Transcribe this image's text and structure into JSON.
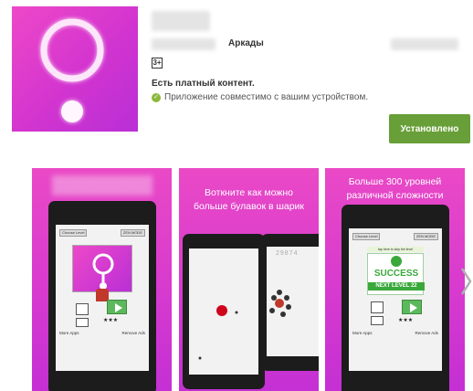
{
  "app": {
    "category": "Аркады",
    "content_rating": "3+",
    "paid_content": "Есть платный контент.",
    "compatibility": "Приложение совместимо с вашим устройством.",
    "install_label": "Установлено"
  },
  "screenshots": [
    {
      "caption": "",
      "menu": {
        "choose_level": "Choose Level",
        "zen_mode": "ZEN MODE",
        "stars": "★★★",
        "more_apps": "More Apps",
        "remove_ads": "Remove Ads"
      }
    },
    {
      "caption_line1": "Воткните как можно",
      "caption_line2": "больше булавок в шарик",
      "counter": "29874"
    },
    {
      "caption_line1": "Больше 300 уровней",
      "caption_line2": "различной сложности",
      "menu": {
        "choose_level": "Choose Level",
        "zen_mode": "ZEN MODE",
        "tap_hint": "tap here to skip the level",
        "success": "SUCCESS",
        "next_level": "NEXT LEVEL 22",
        "stars": "★★★",
        "more_apps": "More Apps",
        "remove_ads": "Remove Ads"
      }
    }
  ],
  "colors": {
    "icon_gradient_start": "#ee48c8",
    "icon_gradient_end": "#b92fd6",
    "install_button": "#689f38",
    "success_green": "#3aa83a"
  },
  "icons": {
    "app_icon": "ring-pin-icon",
    "compat_icon": "check-circle-icon",
    "next": "chevron-right-icon"
  }
}
